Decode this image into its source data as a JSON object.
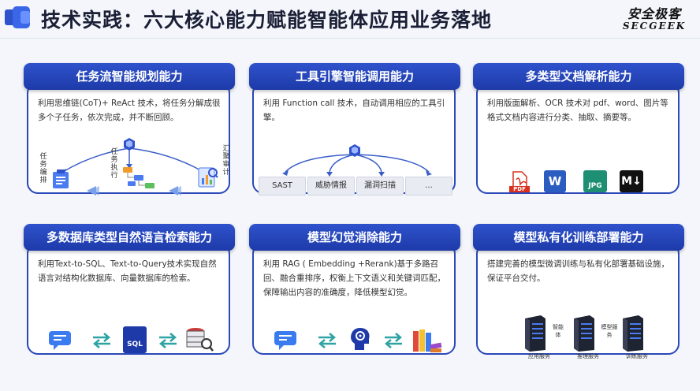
{
  "header": {
    "title": "技术实践：六大核心能力赋能智能体应用业务落地",
    "logo_cn": "安全极客",
    "logo_en": "SECGEEK"
  },
  "colors": {
    "primary": "#1d3aa8",
    "accent": "#2a48b8",
    "title": "#1a1f36"
  },
  "cards": [
    {
      "title": "任务流智能规划能力",
      "desc": "利用思维链(CoT)+ ReAct 技术，将任务分解成很多个子任务，依次完成，并不断回顾。",
      "labels": [
        "任务编排",
        "任务执行",
        "汇聚审计"
      ]
    },
    {
      "title": "工具引擎智能调用能力",
      "desc": "利用 Function call 技术，自动调用相应的工具引擎。",
      "tools": [
        "SAST",
        "威胁情报",
        "漏洞扫描",
        "..."
      ]
    },
    {
      "title": "多类型文档解析能力",
      "desc": "利用版面解析、OCR 技术对 pdf、word、图片等格式文档内容进行分类、抽取、摘要等。",
      "icons": [
        "PDF",
        "W",
        "JPG",
        "M↓"
      ]
    },
    {
      "title": "多数据库类型自然语言检索能力",
      "desc": "利用Text-to-SQL、Text-to-Query技术实现自然语言对结构化数据库、向量数据库的检索。",
      "sql_label": "SQL"
    },
    {
      "title": "模型幻觉消除能力",
      "desc": "利用 RAG ( Embedding +Rerank)基于多路召回、融合重排序，权衡上下文语义和关键词匹配，保障输出内容的准确度，降低模型幻觉。"
    },
    {
      "title": "模型私有化训练部署能力",
      "desc": "搭建完善的模型微调训练与私有化部署基础设施，保证平台交付。",
      "servers": [
        "应用服务",
        "推理服务",
        "训练服务"
      ],
      "server_tags": [
        "智能体",
        "模型服务"
      ]
    }
  ]
}
